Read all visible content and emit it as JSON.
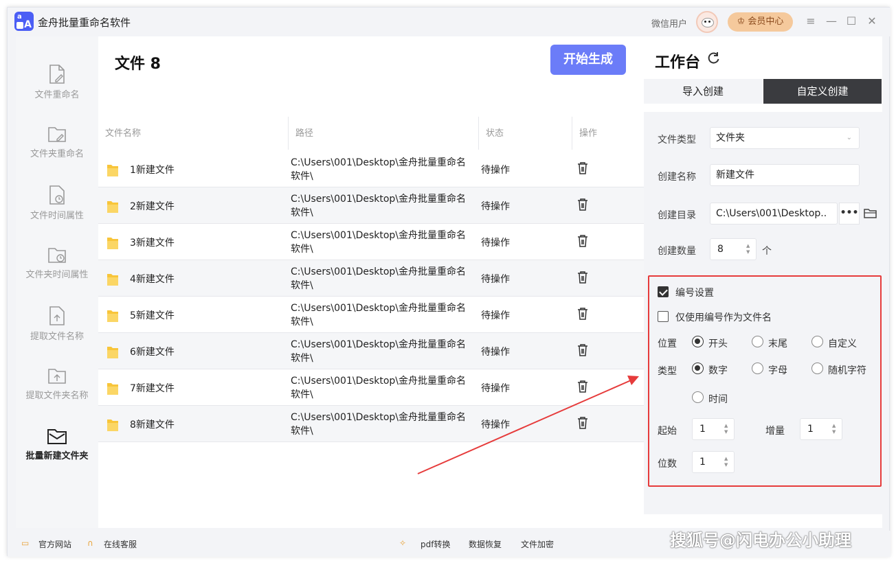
{
  "app": {
    "title": "金舟批量重命名软件",
    "user_name": "微信用户",
    "vip_label": "会员中心"
  },
  "sidebar": {
    "items": [
      {
        "label": "文件重命名",
        "icon": "file-edit-icon"
      },
      {
        "label": "文件夹重命名",
        "icon": "folder-edit-icon"
      },
      {
        "label": "文件时间属性",
        "icon": "file-clock-icon"
      },
      {
        "label": "文件夹时间属性",
        "icon": "folder-clock-icon"
      },
      {
        "label": "提取文件名称",
        "icon": "file-upload-icon"
      },
      {
        "label": "提取文件夹名称",
        "icon": "folder-upload-icon"
      },
      {
        "label": "批量新建文件夹",
        "icon": "new-folder-icon"
      }
    ],
    "active_index": 6
  },
  "main": {
    "title": "文件 8",
    "start_button": "开始生成",
    "columns": [
      "文件名称",
      "路径",
      "状态",
      "操作"
    ],
    "rows": [
      {
        "name": "1新建文件",
        "path": "C:\\Users\\001\\Desktop\\金舟批量重命名软件\\",
        "status": "待操作"
      },
      {
        "name": "2新建文件",
        "path": "C:\\Users\\001\\Desktop\\金舟批量重命名软件\\",
        "status": "待操作"
      },
      {
        "name": "3新建文件",
        "path": "C:\\Users\\001\\Desktop\\金舟批量重命名软件\\",
        "status": "待操作"
      },
      {
        "name": "4新建文件",
        "path": "C:\\Users\\001\\Desktop\\金舟批量重命名软件\\",
        "status": "待操作"
      },
      {
        "name": "5新建文件",
        "path": "C:\\Users\\001\\Desktop\\金舟批量重命名软件\\",
        "status": "待操作"
      },
      {
        "name": "6新建文件",
        "path": "C:\\Users\\001\\Desktop\\金舟批量重命名软件\\",
        "status": "待操作"
      },
      {
        "name": "7新建文件",
        "path": "C:\\Users\\001\\Desktop\\金舟批量重命名软件\\",
        "status": "待操作"
      },
      {
        "name": "8新建文件",
        "path": "C:\\Users\\001\\Desktop\\金舟批量重命名软件\\",
        "status": "待操作"
      }
    ]
  },
  "workspace": {
    "title": "工作台",
    "tabs": {
      "import": "导入创建",
      "custom": "自定义创建"
    },
    "file_type": {
      "label": "文件类型",
      "value": "文件夹"
    },
    "create_name": {
      "label": "创建名称",
      "value": "新建文件"
    },
    "create_dir": {
      "label": "创建目录",
      "value": "C:\\Users\\001\\Desktop.."
    },
    "create_count": {
      "label": "创建数量",
      "value": "8",
      "unit": "个"
    },
    "numbering": {
      "enabled_label": "编号设置",
      "enabled": true,
      "only_number_label": "仅使用编号作为文件名",
      "only_number": false,
      "position_label": "位置",
      "position_options": [
        "开头",
        "末尾",
        "自定义"
      ],
      "position_selected": 0,
      "type_label": "类型",
      "type_options": [
        "数字",
        "字母",
        "随机字符",
        "时间"
      ],
      "type_selected": 0,
      "start_label": "起始",
      "start_value": "1",
      "increment_label": "增量",
      "increment_value": "1",
      "digits_label": "位数",
      "digits_value": "1"
    }
  },
  "bottom": {
    "official_site": "官方网站",
    "online_service": "在线客服",
    "pdf_convert": "pdf转换",
    "data_recovery": "数据恢复",
    "file_encrypt": "文件加密"
  },
  "watermark": "搜狐号@闪电办公小助理",
  "colors": {
    "accent": "#6b7cf8",
    "highlight_border": "#e63b3b",
    "active_tab": "#3a3b3f",
    "vip": "#f5c99c",
    "folder": "#f8c53a"
  }
}
